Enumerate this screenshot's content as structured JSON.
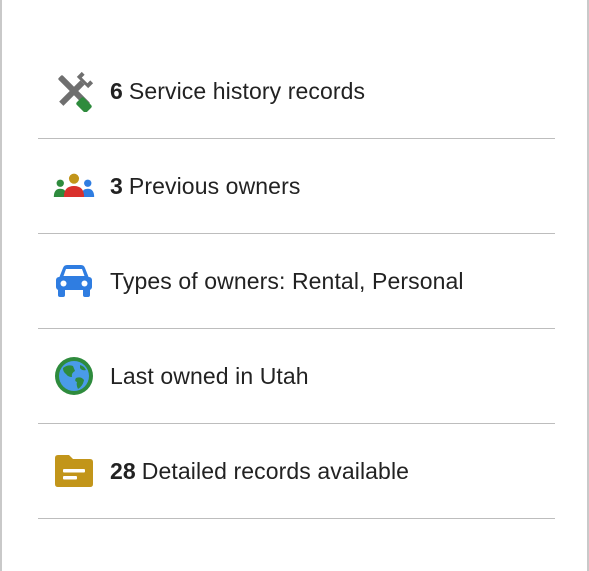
{
  "items": [
    {
      "icon": "tools-icon",
      "count": "6",
      "label": "Service history records"
    },
    {
      "icon": "people-icon",
      "count": "3",
      "label": "Previous owners"
    },
    {
      "icon": "car-icon",
      "count": "",
      "label": "Types of owners: Rental, Personal"
    },
    {
      "icon": "globe-icon",
      "count": "",
      "label": "Last owned in Utah"
    },
    {
      "icon": "folder-icon",
      "count": "28",
      "label": "Detailed records available"
    }
  ],
  "colors": {
    "green": "#2e8b3d",
    "gray": "#6f6f6f",
    "red": "#d9302c",
    "gold": "#c2951a",
    "blue": "#2f7de1",
    "divider": "#bdbdbd"
  }
}
